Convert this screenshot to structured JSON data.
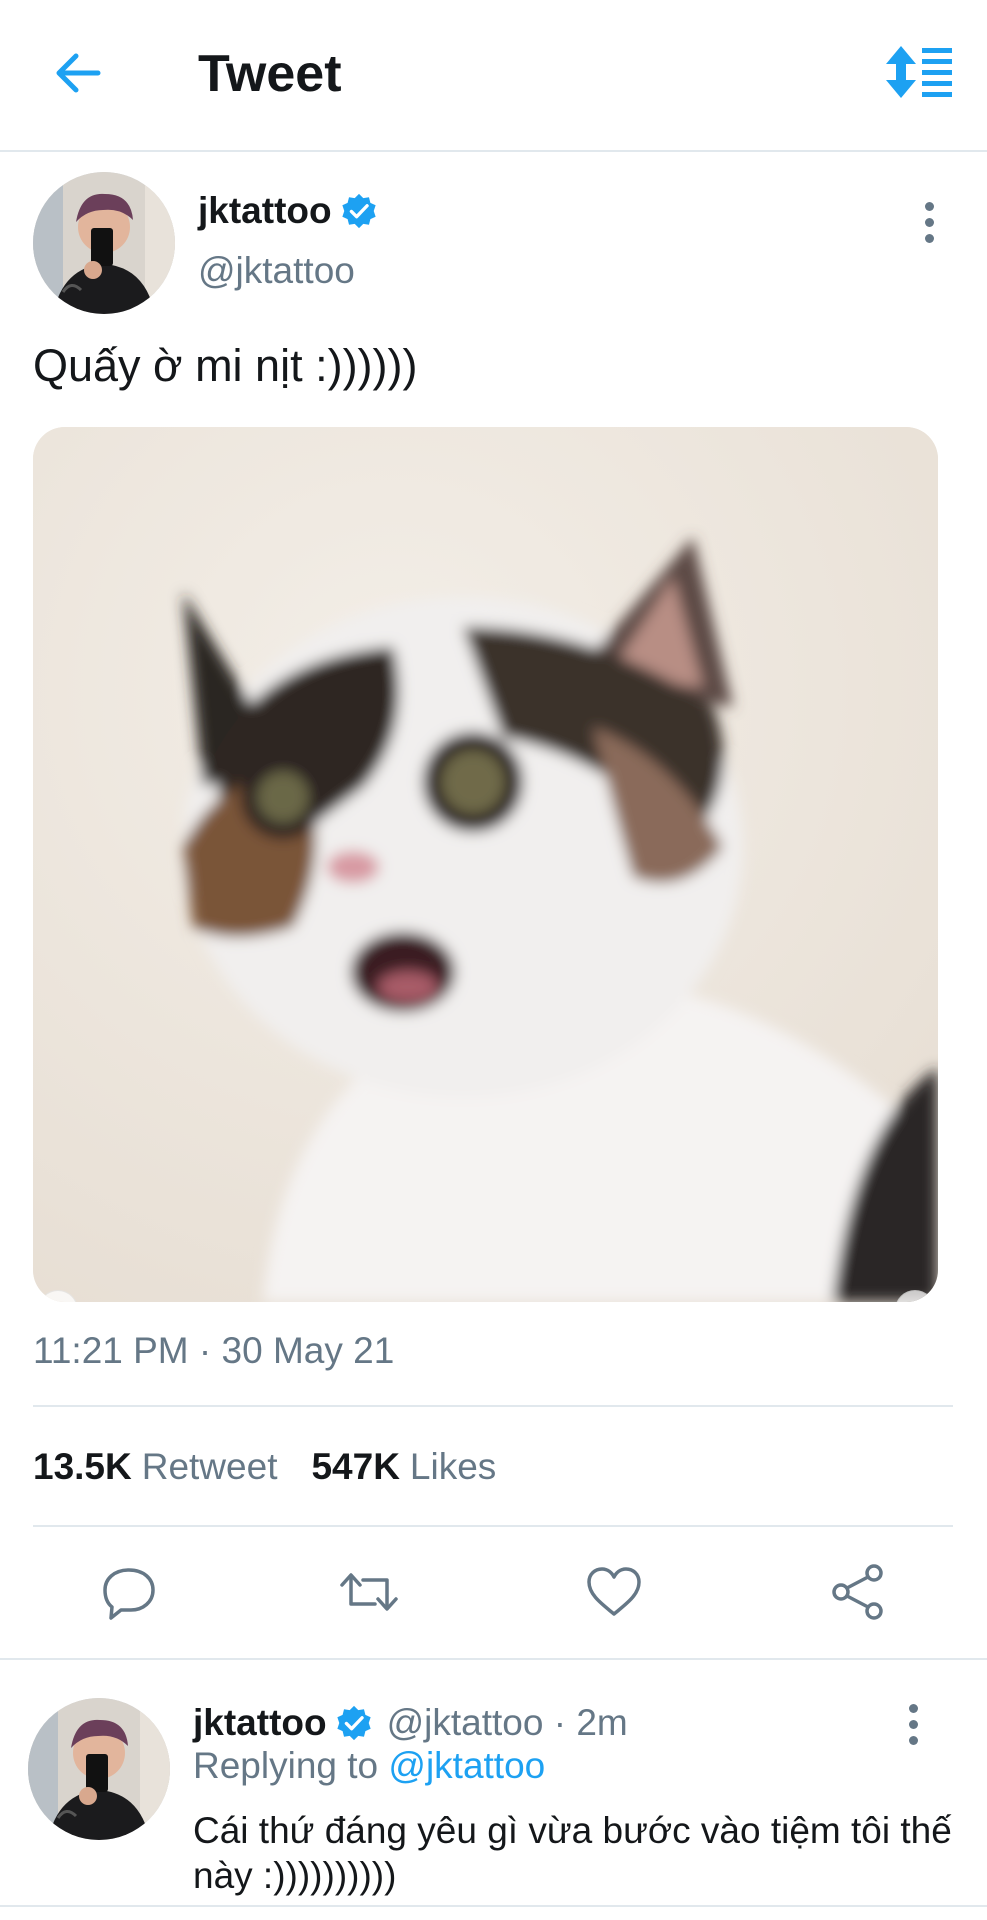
{
  "header": {
    "title": "Tweet",
    "back_icon": "arrow-left-icon",
    "sort_icon": "sort-icon",
    "accent": "#1da1f2"
  },
  "tweet": {
    "author_name": "jktattoo",
    "verified": true,
    "handle": "@jktattoo",
    "text": "Quấy ờ mi nịt :))))))",
    "media": {
      "description_icon": "cat-photo",
      "prev_icon": "chevron-left-icon",
      "next_icon": "chevron-right-icon"
    },
    "timestamp": "11:21 PM · 30 May 21",
    "retweet_count": "13.5K",
    "retweet_label": "Retweet",
    "like_count": "547K",
    "like_label": "Likes",
    "actions": [
      "reply-icon",
      "retweet-icon",
      "like-icon",
      "share-icon"
    ]
  },
  "reply": {
    "author_name": "jktattoo",
    "verified": true,
    "handle_time": "@jktattoo · 2m",
    "replying_prefix": "Replying to",
    "replying_to": "@jktattoo",
    "text": "Cái thứ đáng yêu gì vừa bước vào tiệm tôi thế này :))))))))))"
  },
  "colors": {
    "text_primary": "#14171a",
    "text_secondary": "#657786",
    "accent": "#1da1f2",
    "divider": "#e1e8ed"
  }
}
